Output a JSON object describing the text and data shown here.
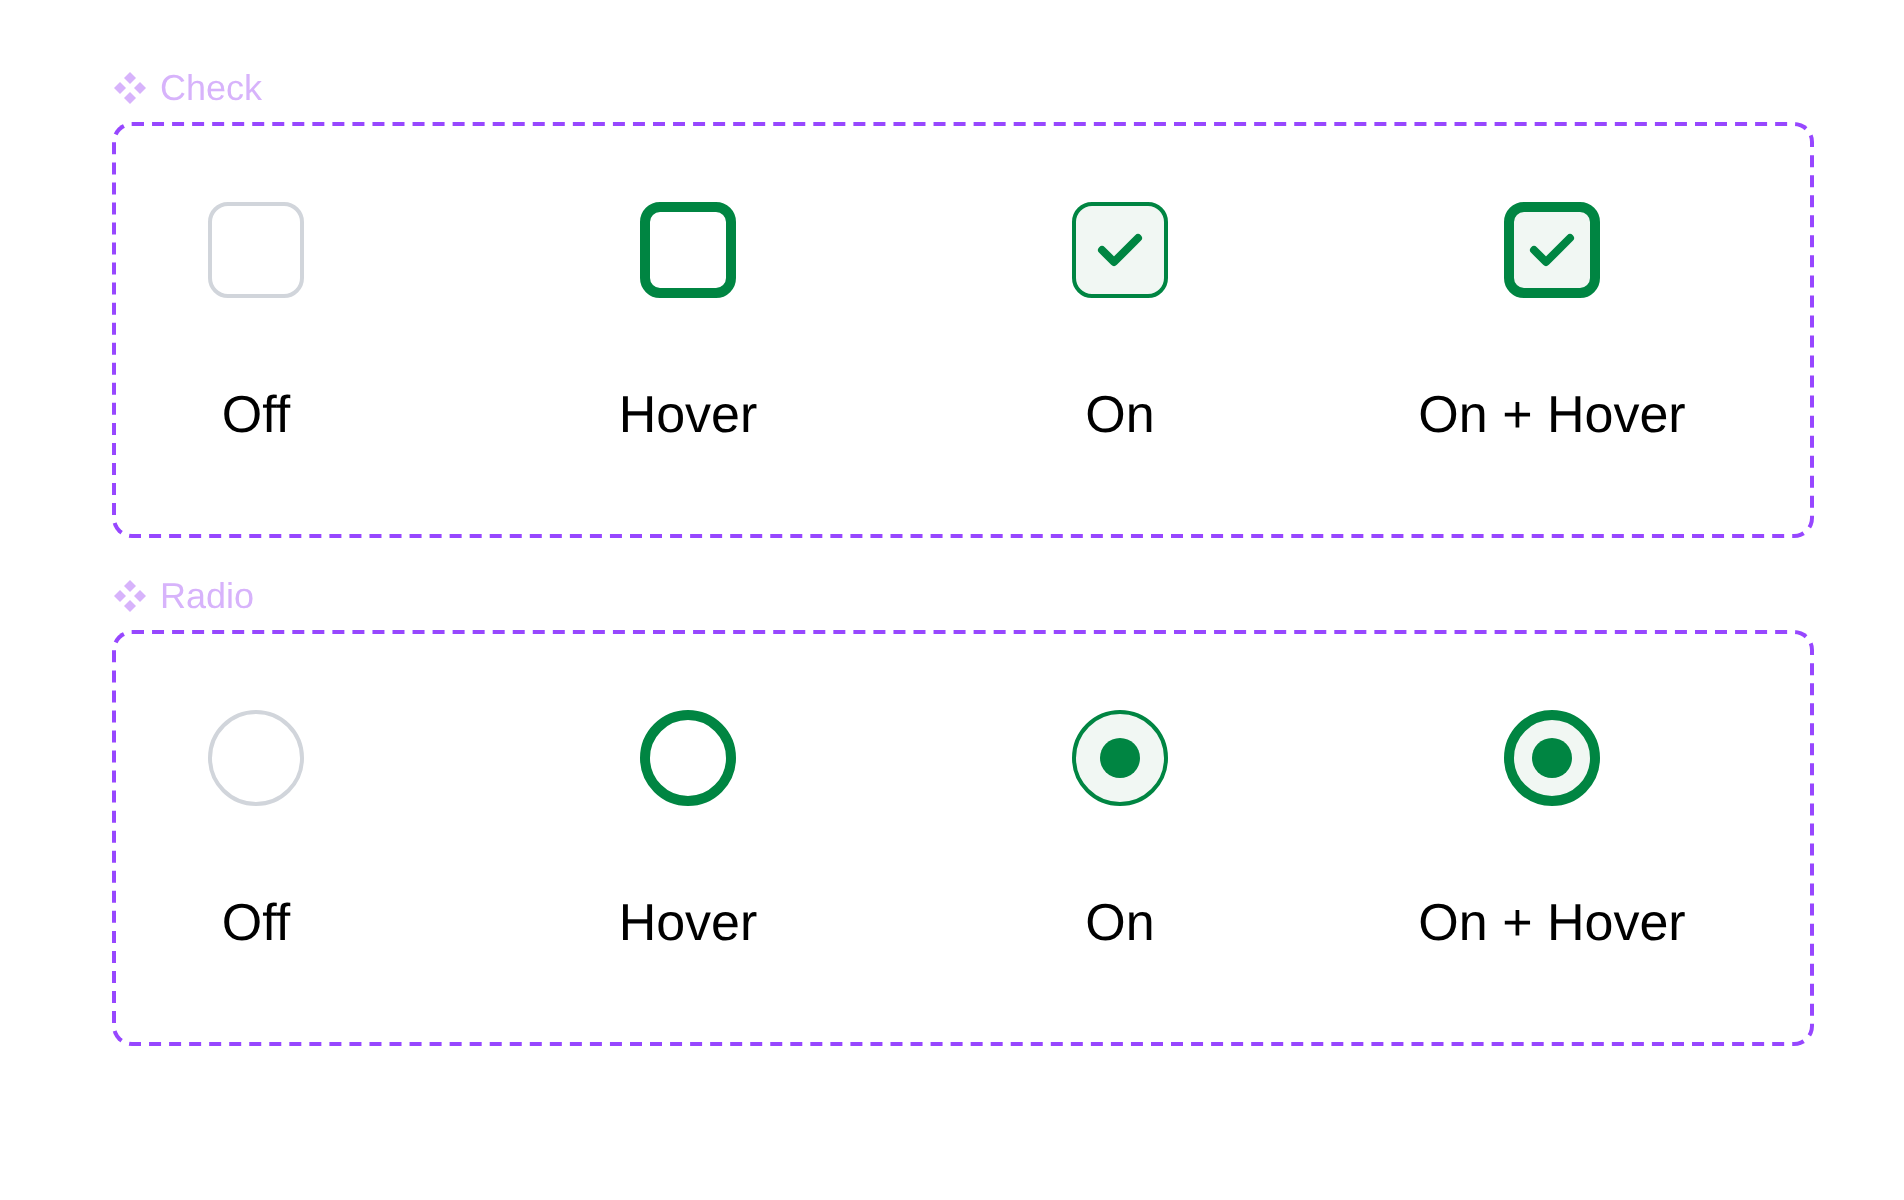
{
  "sets": [
    {
      "title": "Check",
      "kind": "checkbox",
      "variants": [
        {
          "label": "Off",
          "checked": false,
          "hovered": false
        },
        {
          "label": "Hover",
          "checked": false,
          "hovered": true
        },
        {
          "label": "On",
          "checked": true,
          "hovered": false
        },
        {
          "label": "On + Hover",
          "checked": true,
          "hovered": true
        }
      ]
    },
    {
      "title": "Radio",
      "kind": "radio",
      "variants": [
        {
          "label": "Off",
          "checked": false,
          "hovered": false
        },
        {
          "label": "Hover",
          "checked": false,
          "hovered": true
        },
        {
          "label": "On",
          "checked": true,
          "hovered": false
        },
        {
          "label": "On + Hover",
          "checked": true,
          "hovered": true
        }
      ]
    }
  ]
}
